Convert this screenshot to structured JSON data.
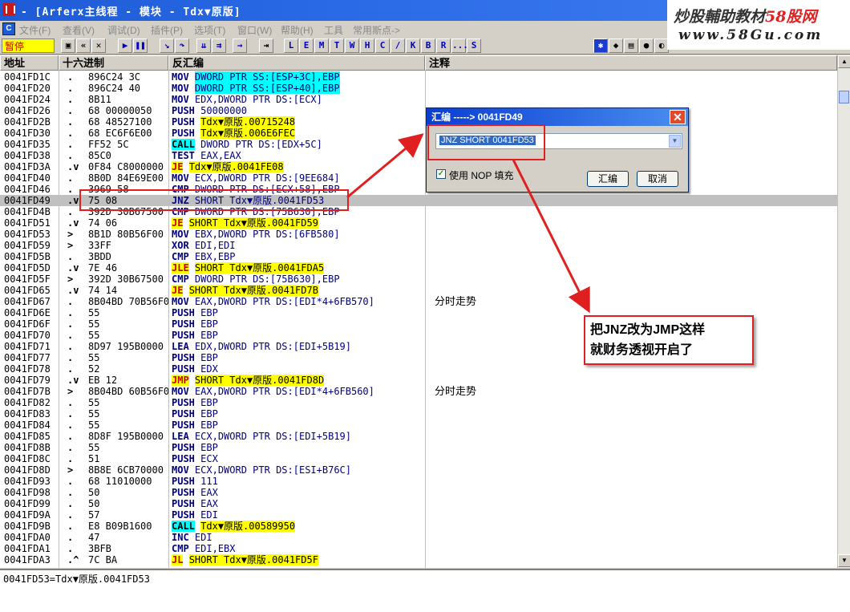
{
  "titlebar": {
    "title": "- [Arferx主线程 - 模块 - Tdx▼原版]"
  },
  "watermark": {
    "line1_prefix": "炒股輔助教材",
    "line1_brand": "58股网",
    "line2": "www.58Gu.com"
  },
  "menu": [
    "文件(F)",
    "查看(V)",
    "调试(D)",
    "插件(P)",
    "选项(T)",
    "窗口(W)",
    "帮助(H)",
    "工具",
    "常用斯点->"
  ],
  "toolbar": {
    "status": "暂停",
    "letters": [
      "L",
      "E",
      "M",
      "T",
      "W",
      "H",
      "C",
      "/",
      "K",
      "B",
      "R",
      "...",
      "S"
    ]
  },
  "columns": {
    "addr": "地址",
    "hex": "十六进制",
    "disasm": "反汇编",
    "comment": "注释"
  },
  "rows": [
    {
      "addr": "0041FD1C",
      "mark": ".",
      "hex": "896C24 3C",
      "mn": "MOV",
      "op": "DWORD PTR SS:[ESP+3C],EBP",
      "seg": true
    },
    {
      "addr": "0041FD20",
      "mark": ".",
      "hex": "896C24 40",
      "mn": "MOV",
      "op": "DWORD PTR SS:[ESP+40],EBP",
      "seg": true
    },
    {
      "addr": "0041FD24",
      "mark": ".",
      "hex": "8B11",
      "mn": "MOV",
      "op": "EDX,DWORD PTR DS:[ECX]"
    },
    {
      "addr": "0041FD26",
      "mark": ".",
      "hex": "68 00000050",
      "mn": "PUSH",
      "op": "50000000"
    },
    {
      "addr": "0041FD2B",
      "mark": ".",
      "hex": "68 48527100",
      "mn": "PUSH",
      "op": "Tdx▼原版.00715248",
      "hl": true
    },
    {
      "addr": "0041FD30",
      "mark": ".",
      "hex": "68 EC6F6E00",
      "mn": "PUSH",
      "op": "Tdx▼原版.006E6FEC",
      "hl": true
    },
    {
      "addr": "0041FD35",
      "mark": ".",
      "hex": "FF52 5C",
      "mn": "CALL",
      "op": "DWORD PTR DS:[EDX+5C]",
      "kind": "call"
    },
    {
      "addr": "0041FD38",
      "mark": ".",
      "hex": "85C0",
      "mn": "TEST",
      "op": "EAX,EAX"
    },
    {
      "addr": "0041FD3A",
      "mark": ".v",
      "hex": "0F84 C8000000",
      "mn": "JE",
      "op": "Tdx▼原版.0041FE08",
      "kind": "jmp",
      "hl": true
    },
    {
      "addr": "0041FD40",
      "mark": ".",
      "hex": "8B0D 84E69E00",
      "mn": "MOV",
      "op": "ECX,DWORD PTR DS:[9EE684]"
    },
    {
      "addr": "0041FD46",
      "mark": ".",
      "hex": "3969 58",
      "mn": "CMP",
      "op": "DWORD PTR DS:[ECX+58],EBP"
    },
    {
      "addr": "0041FD49",
      "mark": ".v",
      "hex": "75 08",
      "mn": "JNZ",
      "op": "SHORT Tdx▼原版.0041FD53",
      "current": true
    },
    {
      "addr": "0041FD4B",
      "mark": ".",
      "hex": "392D 30B67500",
      "mn": "CMP",
      "op": "DWORD PTR DS:[75B630],EBP"
    },
    {
      "addr": "0041FD51",
      "mark": ".v",
      "hex": "74 06",
      "mn": "JE",
      "op": "SHORT Tdx▼原版.0041FD59",
      "kind": "jmp",
      "hl": true
    },
    {
      "addr": "0041FD53",
      "mark": ">",
      "hex": "8B1D 80B56F00",
      "mn": "MOV",
      "op": "EBX,DWORD PTR DS:[6FB580]"
    },
    {
      "addr": "0041FD59",
      "mark": ">",
      "hex": "33FF",
      "mn": "XOR",
      "op": "EDI,EDI"
    },
    {
      "addr": "0041FD5B",
      "mark": ".",
      "hex": "3BDD",
      "mn": "CMP",
      "op": "EBX,EBP"
    },
    {
      "addr": "0041FD5D",
      "mark": ".v",
      "hex": "7E 46",
      "mn": "JLE",
      "op": "SHORT Tdx▼原版.0041FDA5",
      "kind": "jmp",
      "hl": true
    },
    {
      "addr": "0041FD5F",
      "mark": ">",
      "hex": "392D 30B67500",
      "mn": "CMP",
      "op": "DWORD PTR DS:[75B630],EBP"
    },
    {
      "addr": "0041FD65",
      "mark": ".v",
      "hex": "74 14",
      "mn": "JE",
      "op": "SHORT Tdx▼原版.0041FD7B",
      "kind": "jmp",
      "hl": true
    },
    {
      "addr": "0041FD67",
      "mark": ".",
      "hex": "8B04BD 70B56F00",
      "mn": "MOV",
      "op": "EAX,DWORD PTR DS:[EDI*4+6FB570]",
      "comment": "分时走势"
    },
    {
      "addr": "0041FD6E",
      "mark": ".",
      "hex": "55",
      "mn": "PUSH",
      "op": "EBP"
    },
    {
      "addr": "0041FD6F",
      "mark": ".",
      "hex": "55",
      "mn": "PUSH",
      "op": "EBP"
    },
    {
      "addr": "0041FD70",
      "mark": ".",
      "hex": "55",
      "mn": "PUSH",
      "op": "EBP"
    },
    {
      "addr": "0041FD71",
      "mark": ".",
      "hex": "8D97 195B0000",
      "mn": "LEA",
      "op": "EDX,DWORD PTR DS:[EDI+5B19]"
    },
    {
      "addr": "0041FD77",
      "mark": ".",
      "hex": "55",
      "mn": "PUSH",
      "op": "EBP"
    },
    {
      "addr": "0041FD78",
      "mark": ".",
      "hex": "52",
      "mn": "PUSH",
      "op": "EDX"
    },
    {
      "addr": "0041FD79",
      "mark": ".v",
      "hex": "EB 12",
      "mn": "JMP",
      "op": "SHORT Tdx▼原版.0041FD8D",
      "kind": "jmp",
      "hl": true
    },
    {
      "addr": "0041FD7B",
      "mark": ">",
      "hex": "8B04BD 60B56F00",
      "mn": "MOV",
      "op": "EAX,DWORD PTR DS:[EDI*4+6FB560]",
      "comment": "分时走势"
    },
    {
      "addr": "0041FD82",
      "mark": ".",
      "hex": "55",
      "mn": "PUSH",
      "op": "EBP"
    },
    {
      "addr": "0041FD83",
      "mark": ".",
      "hex": "55",
      "mn": "PUSH",
      "op": "EBP"
    },
    {
      "addr": "0041FD84",
      "mark": ".",
      "hex": "55",
      "mn": "PUSH",
      "op": "EBP"
    },
    {
      "addr": "0041FD85",
      "mark": ".",
      "hex": "8D8F 195B0000",
      "mn": "LEA",
      "op": "ECX,DWORD PTR DS:[EDI+5B19]"
    },
    {
      "addr": "0041FD8B",
      "mark": ".",
      "hex": "55",
      "mn": "PUSH",
      "op": "EBP"
    },
    {
      "addr": "0041FD8C",
      "mark": ".",
      "hex": "51",
      "mn": "PUSH",
      "op": "ECX"
    },
    {
      "addr": "0041FD8D",
      "mark": ">",
      "hex": "8B8E 6CB70000",
      "mn": "MOV",
      "op": "ECX,DWORD PTR DS:[ESI+B76C]"
    },
    {
      "addr": "0041FD93",
      "mark": ".",
      "hex": "68 11010000",
      "mn": "PUSH",
      "op": "111"
    },
    {
      "addr": "0041FD98",
      "mark": ".",
      "hex": "50",
      "mn": "PUSH",
      "op": "EAX"
    },
    {
      "addr": "0041FD99",
      "mark": ".",
      "hex": "50",
      "mn": "PUSH",
      "op": "EAX"
    },
    {
      "addr": "0041FD9A",
      "mark": ".",
      "hex": "57",
      "mn": "PUSH",
      "op": "EDI"
    },
    {
      "addr": "0041FD9B",
      "mark": ".",
      "hex": "E8 B09B1600",
      "mn": "CALL",
      "op": "Tdx▼原版.00589950",
      "kind": "call",
      "hl": true
    },
    {
      "addr": "0041FDA0",
      "mark": ".",
      "hex": "47",
      "mn": "INC",
      "op": "EDI"
    },
    {
      "addr": "0041FDA1",
      "mark": ".",
      "hex": "3BFB",
      "mn": "CMP",
      "op": "EDI,EBX"
    },
    {
      "addr": "0041FDA3",
      "mark": ".^",
      "hex": "7C BA",
      "mn": "JL",
      "op": "SHORT Tdx▼原版.0041FD5F",
      "kind": "jmp",
      "hl": true
    }
  ],
  "info": "0041FD53=Tdx▼原版.0041FD53",
  "dialog": {
    "title": "汇编 -----> 0041FD49",
    "close": "✕",
    "input_value": "JNZ SHORT 0041FD53",
    "checkbox_label": "使用 NOP 填充",
    "assemble_button": "汇编",
    "cancel_button": "取消"
  },
  "callout": {
    "line1": "把JNZ改为JMP这样",
    "line2": "就财务透视开启了"
  }
}
